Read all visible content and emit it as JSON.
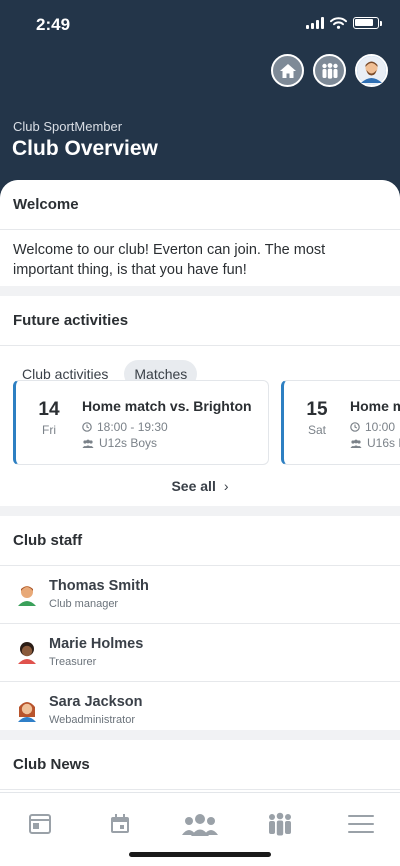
{
  "status": {
    "time": "2:49"
  },
  "header": {
    "club_sub": "Club SportMember",
    "title": "Club Overview",
    "actions": [
      "home-icon",
      "team-icon",
      "profile-avatar"
    ]
  },
  "welcome": {
    "title": "Welcome",
    "text": "Welcome to our club! Everton can join. The most important thing, is that you have fun!"
  },
  "future": {
    "title": "Future activities",
    "tabs": [
      {
        "label": "Club activities",
        "active": false
      },
      {
        "label": "Matches",
        "active": true
      }
    ],
    "activities": [
      {
        "day": "14",
        "weekday": "Fri",
        "title": "Home match vs. Brighton",
        "time": "18:00 - 19:30",
        "team": "U12s Boys"
      },
      {
        "day": "15",
        "weekday": "Sat",
        "title": "Home m",
        "time": "10:00",
        "team": "U16s B"
      }
    ],
    "see_all": "See all",
    "accent": "#2d7fc2"
  },
  "staff": {
    "title": "Club staff",
    "members": [
      {
        "name": "Thomas Smith",
        "role": "Club manager"
      },
      {
        "name": "Marie Holmes",
        "role": "Treasurer"
      },
      {
        "name": "Sara Jackson",
        "role": "Webadministrator"
      }
    ]
  },
  "news": {
    "title": "Club News"
  },
  "nav": [
    "news-icon",
    "calendar-icon",
    "members-icon",
    "teams-icon",
    "menu-icon"
  ],
  "colors": {
    "header_bg": "#233549",
    "page_bg": "#f1f2f4"
  }
}
